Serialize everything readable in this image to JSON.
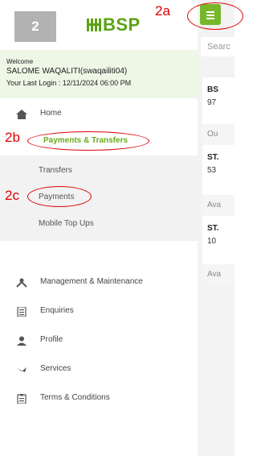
{
  "drawer": {
    "logo_box_text": "2",
    "brand_name": "BSP",
    "welcome_label": "Welcome",
    "user_name": "SALOME WAQALITI(swaqailiti04)",
    "last_login": "Your Last Login : 12/11/2024 06:00 PM",
    "menu": [
      {
        "label": "Home",
        "icon": "home-icon"
      },
      {
        "label": "Payments & Transfers",
        "icon": "none",
        "active": true
      },
      {
        "label": "Management & Maintenance",
        "icon": "tools-icon"
      },
      {
        "label": "Enquiries",
        "icon": "list-icon"
      },
      {
        "label": "Profile",
        "icon": "person-icon"
      },
      {
        "label": "Services",
        "icon": "services-icon"
      },
      {
        "label": "Terms & Conditions",
        "icon": "clipboard-icon"
      }
    ],
    "submenu": [
      {
        "label": "Transfers"
      },
      {
        "label": "Payments"
      },
      {
        "label": "Mobile Top Ups"
      }
    ]
  },
  "background": {
    "search_placeholder": "Searc",
    "cards": [
      {
        "name": "BS",
        "number": "97",
        "status": "Ou"
      },
      {
        "name": "ST.",
        "number": "53",
        "status": "Ava"
      },
      {
        "name": "ST.",
        "number": "10",
        "status": "Ava"
      }
    ]
  },
  "annotations": {
    "a2a": "2a",
    "a2b": "2b",
    "a2c": "2c"
  },
  "colors": {
    "accent_green": "#76b82a",
    "brand_green": "#5ba316",
    "annotation_red": "#e00000"
  }
}
